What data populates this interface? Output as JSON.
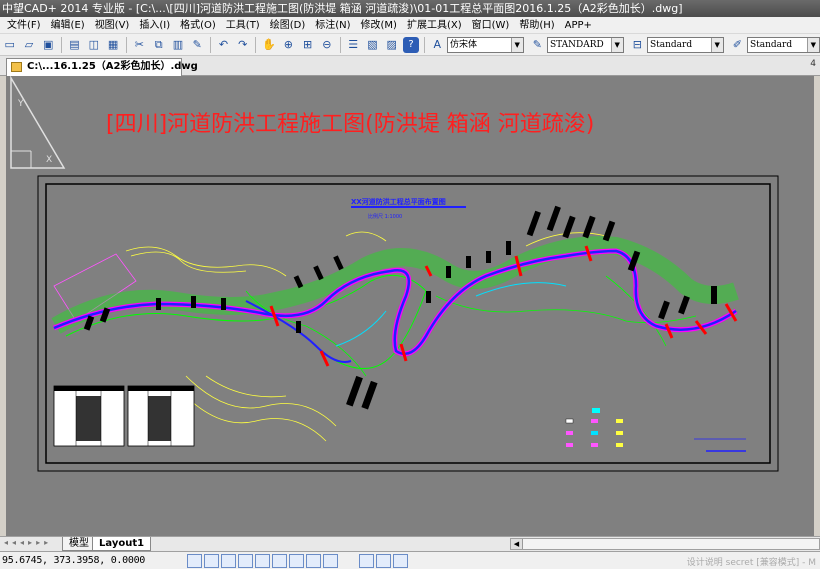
{
  "window": {
    "title": "中望CAD+ 2014 专业版 - [C:\\...\\[四川]河道防洪工程施工图(防洪堤 箱涵 河道疏浚)\\01-01工程总平面图2016.1.25（A2彩色加长）.dwg]"
  },
  "menu": [
    "文件(F)",
    "编辑(E)",
    "视图(V)",
    "插入(I)",
    "格式(O)",
    "工具(T)",
    "绘图(D)",
    "标注(N)",
    "修改(M)",
    "扩展工具(X)",
    "窗口(W)",
    "帮助(H)",
    "APP+"
  ],
  "toolbar": {
    "font_combo": "仿宋体",
    "text_style_combo": "STANDARD",
    "dim_style_combo": "Standard",
    "table_style_combo": "Standard"
  },
  "document": {
    "tab_label": "C:\\...16.1.25（A2彩色加长）.dwg"
  },
  "drawing": {
    "main_title": "[四川]河道防洪工程施工图(防洪堤 箱涵 河道疏浚)",
    "inner_title": "XX河道防洪工程总平面布置图",
    "inner_scale": "比例尺  1:1000"
  },
  "layout_tabs": [
    "模型",
    "Layout1"
  ],
  "layout_active": "Layout1",
  "status": {
    "coordinates": "95.6745,  373.3958,  0.0000",
    "right_text": "设计说明  secret [兼容模式] - M"
  },
  "colors": {
    "canvas_bg": "#808080",
    "title_red": "#ff1f1f",
    "river_blue": "#2020ff",
    "contour_green": "#00ff00",
    "highlight_magenta": "#ff00ff"
  }
}
